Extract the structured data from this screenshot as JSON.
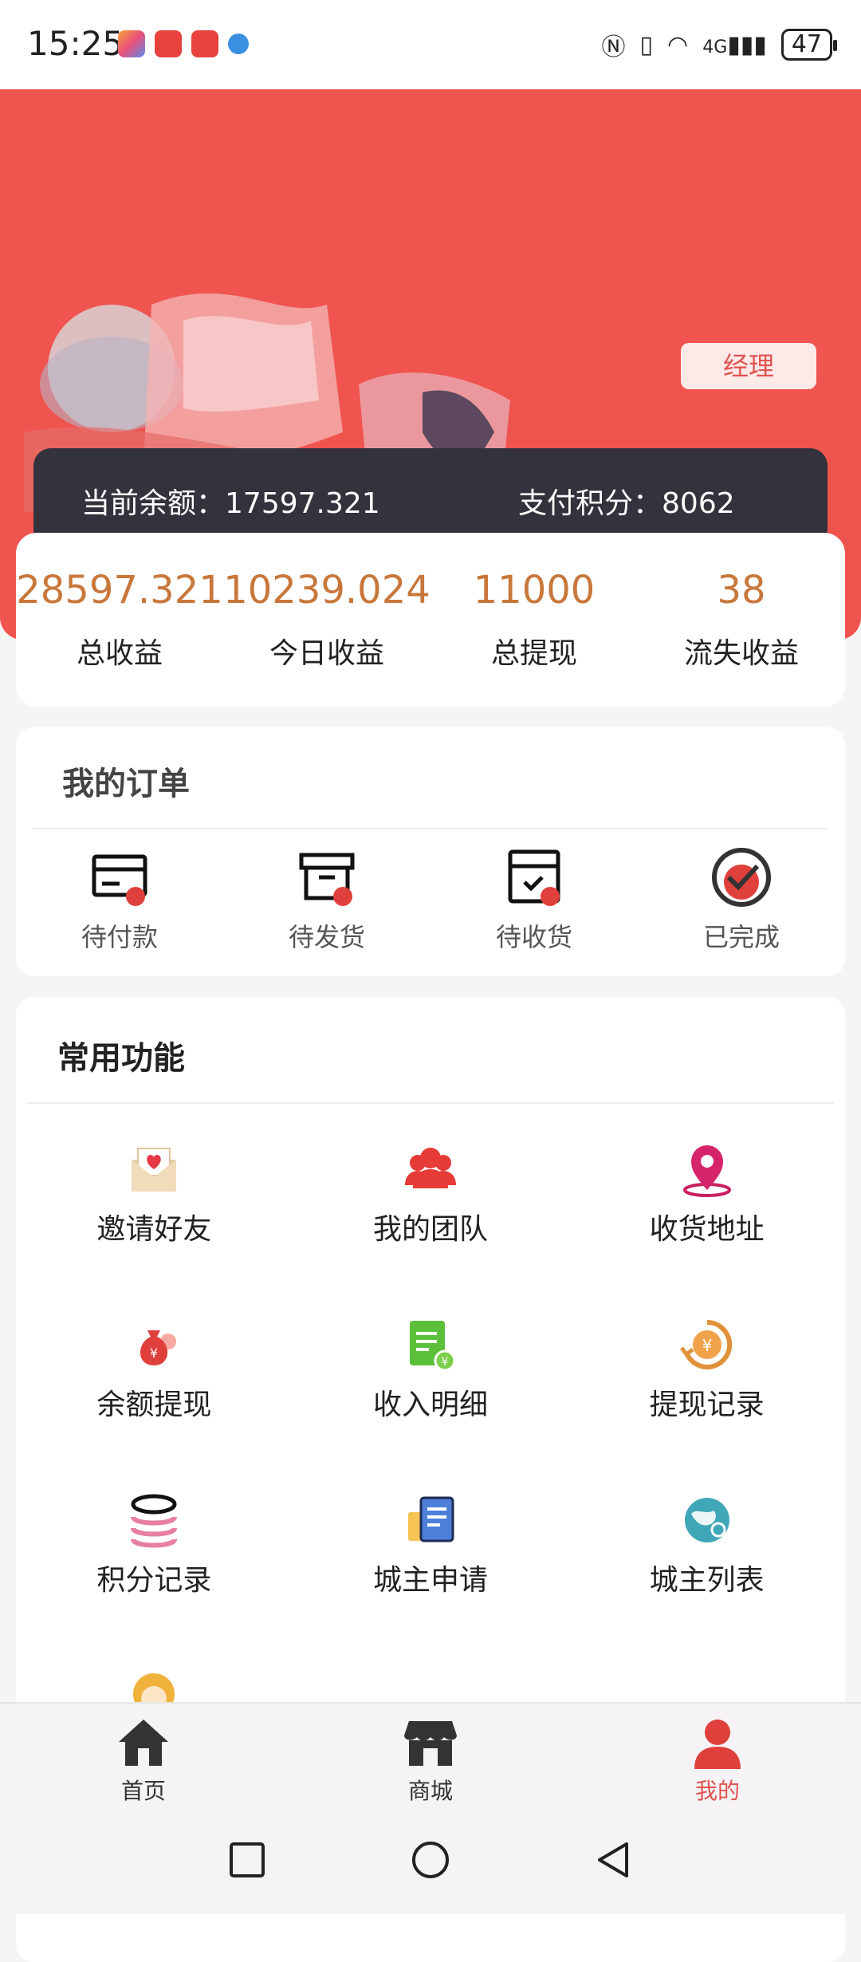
{
  "status_bar": {
    "time": "15:25",
    "battery": "47",
    "network": "4G"
  },
  "header": {
    "role_badge": "经理"
  },
  "balance": {
    "current_label": "当前余额：",
    "current_value": "17597.321",
    "points_label": "支付积分：",
    "points_value": "8062"
  },
  "stats": [
    {
      "value": "28597.321",
      "label": "总收益"
    },
    {
      "value": "10239.024",
      "label": "今日收益"
    },
    {
      "value": "11000",
      "label": "总提现"
    },
    {
      "value": "38",
      "label": "流失收益"
    }
  ],
  "orders": {
    "title": "我的订单",
    "items": [
      {
        "label": "待付款",
        "icon": "card-icon"
      },
      {
        "label": "待发货",
        "icon": "box-icon"
      },
      {
        "label": "待收货",
        "icon": "receive-box-icon"
      },
      {
        "label": "已完成",
        "icon": "check-circle-icon"
      }
    ]
  },
  "functions": {
    "title": "常用功能",
    "items": [
      {
        "label": "邀请好友",
        "icon": "invite-envelope-icon"
      },
      {
        "label": "我的团队",
        "icon": "team-icon"
      },
      {
        "label": "收货地址",
        "icon": "location-pin-icon"
      },
      {
        "label": "余额提现",
        "icon": "money-bag-icon"
      },
      {
        "label": "收入明细",
        "icon": "income-doc-icon"
      },
      {
        "label": "提现记录",
        "icon": "yuan-history-icon"
      },
      {
        "label": "积分记录",
        "icon": "coin-stack-icon"
      },
      {
        "label": "城主申请",
        "icon": "apply-doc-icon"
      },
      {
        "label": "城主列表",
        "icon": "globe-icon"
      }
    ]
  },
  "bottom_nav": [
    {
      "label": "首页",
      "icon": "home-icon"
    },
    {
      "label": "商城",
      "icon": "store-icon"
    },
    {
      "label": "我的",
      "icon": "user-icon",
      "active": true
    }
  ],
  "colors": {
    "primary": "#f0544f",
    "accent_orange": "#c8773b",
    "dark_bar": "#33323d"
  }
}
